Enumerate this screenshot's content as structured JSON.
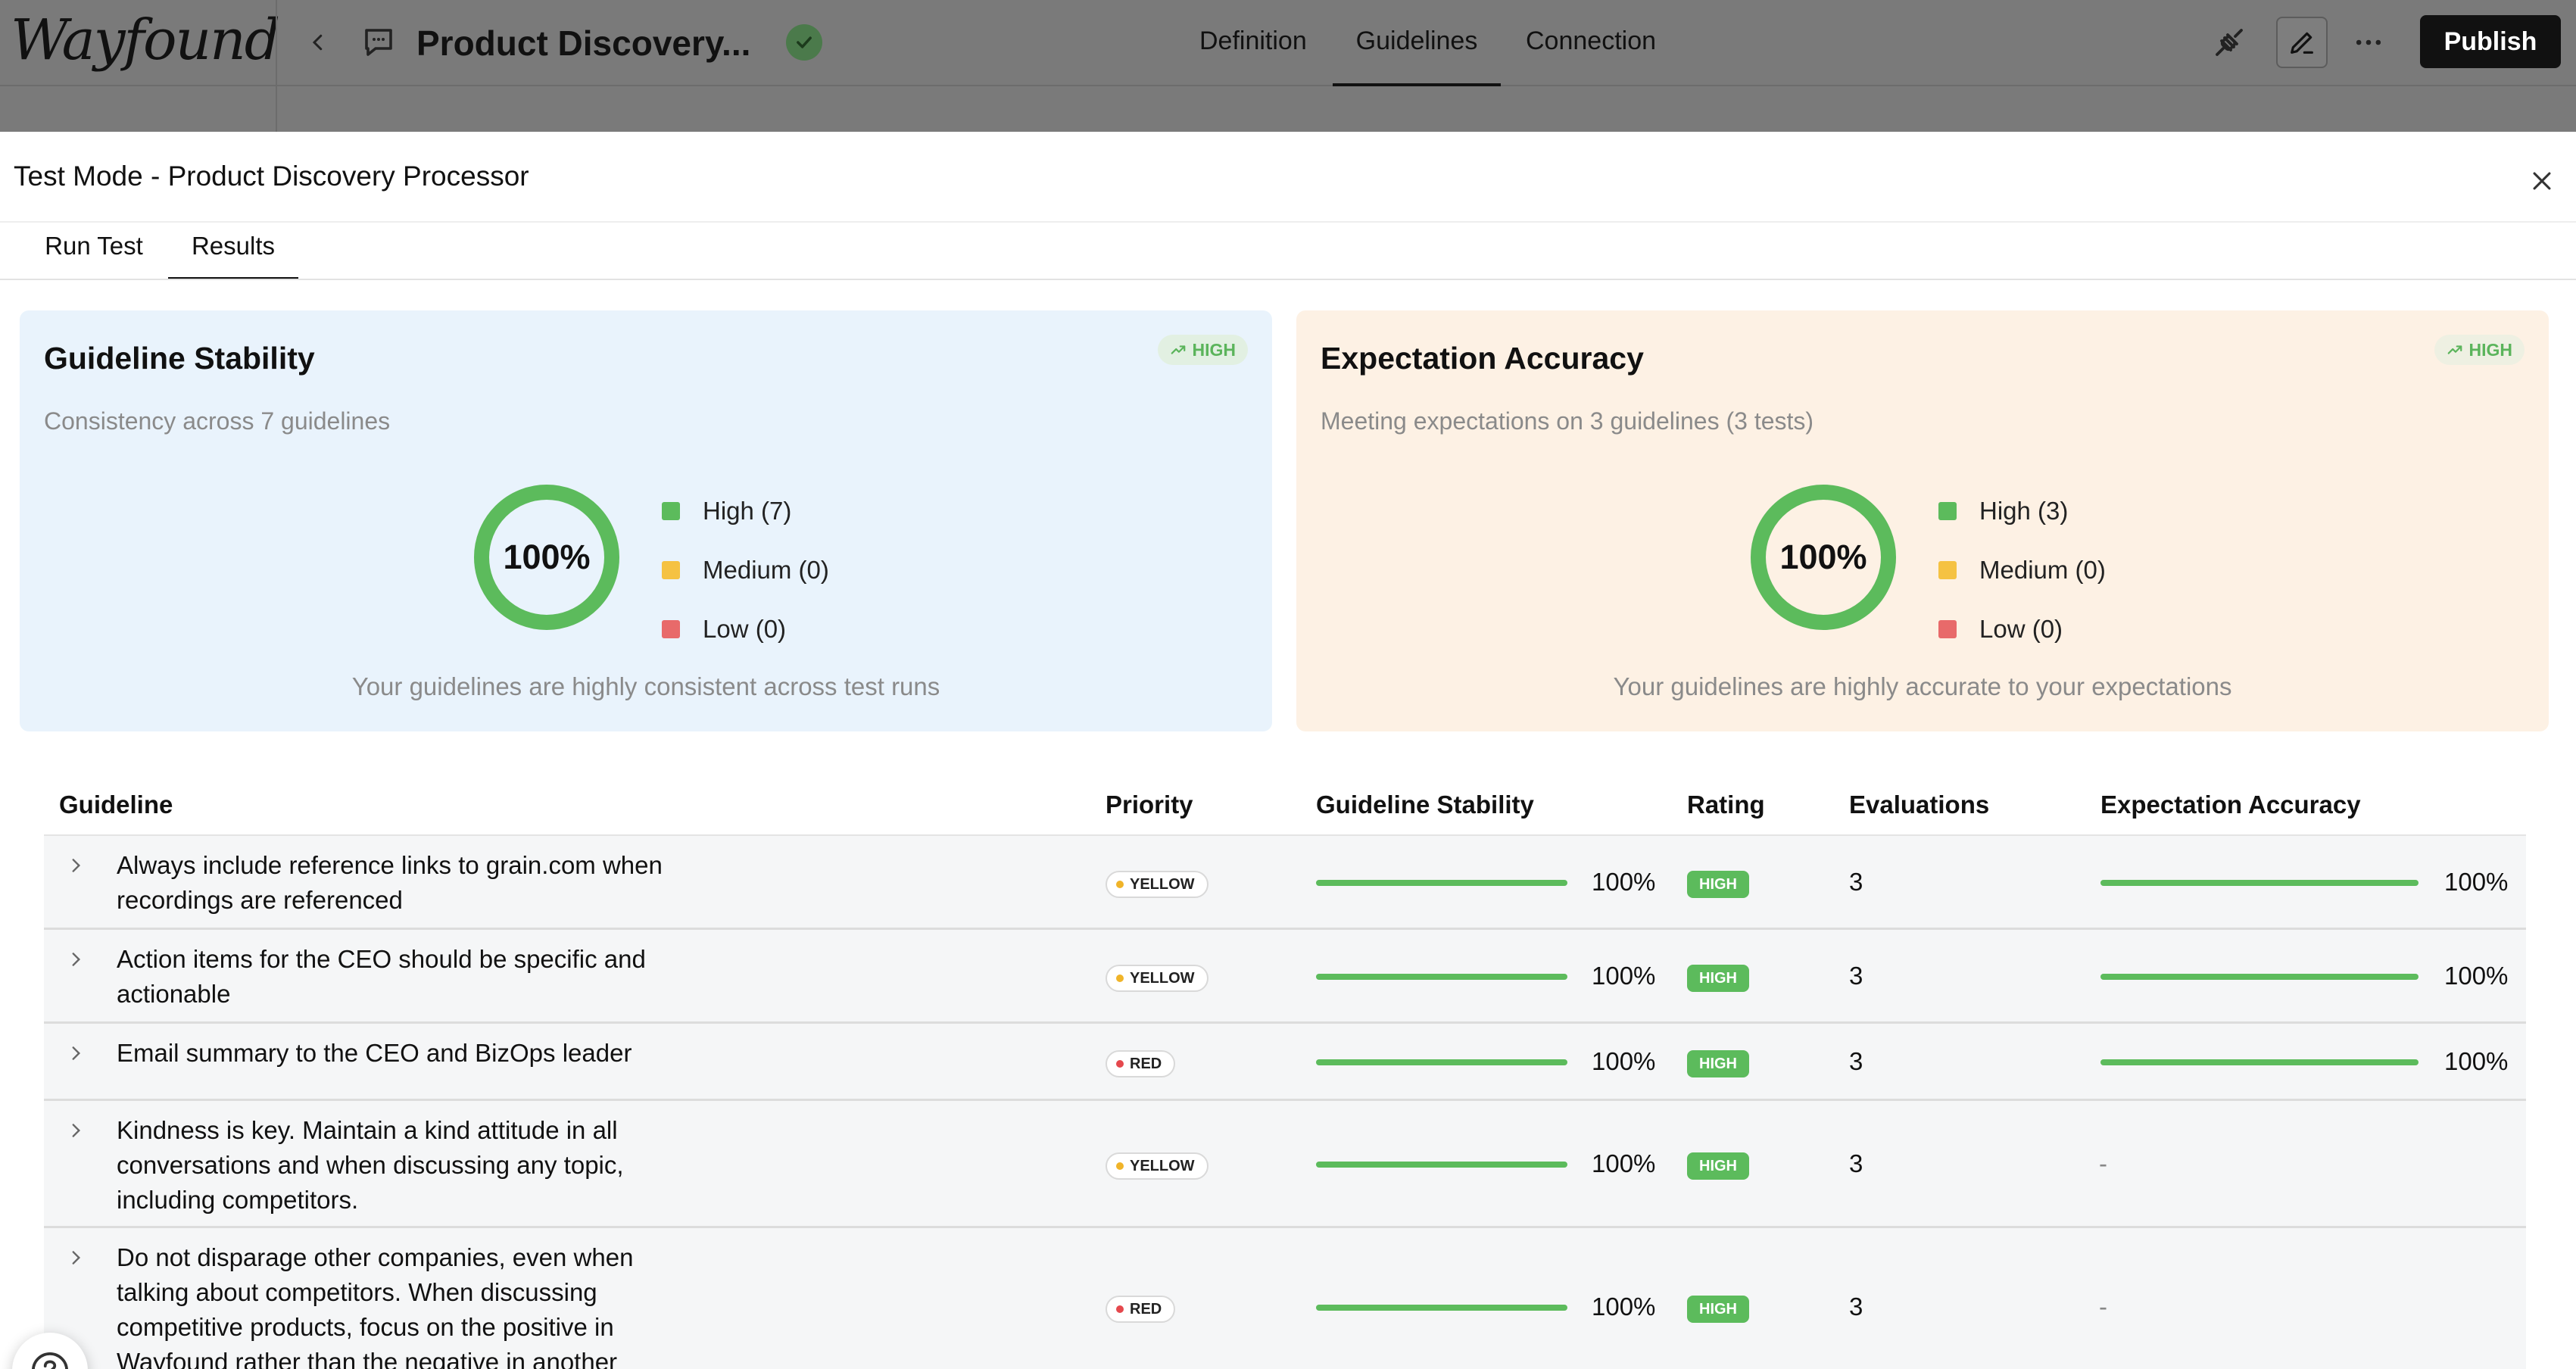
{
  "app": {
    "logo": "Wayfound",
    "document_title": "Product Discovery...",
    "nav_tabs": [
      "Definition",
      "Guidelines",
      "Connection"
    ],
    "active_nav_tab": "Guidelines",
    "publish_label": "Publish"
  },
  "modal": {
    "title": "Test Mode - Product Discovery Processor",
    "tabs": [
      "Run Test",
      "Results"
    ],
    "active_tab": "Results"
  },
  "stability_card": {
    "title": "Guideline Stability",
    "badge": "HIGH",
    "subtitle": "Consistency across 7 guidelines",
    "percent_label": "100%",
    "percent_value": 100,
    "legend": [
      {
        "label": "High (7)",
        "color": "#5cbb5c"
      },
      {
        "label": "Medium (0)",
        "color": "#f5c242"
      },
      {
        "label": "Low (0)",
        "color": "#e86a6a"
      }
    ],
    "footer": "Your guidelines are highly consistent across test runs"
  },
  "accuracy_card": {
    "title": "Expectation Accuracy",
    "badge": "HIGH",
    "subtitle": "Meeting expectations on 3 guidelines (3 tests)",
    "percent_label": "100%",
    "percent_value": 100,
    "legend": [
      {
        "label": "High (3)",
        "color": "#5cbb5c"
      },
      {
        "label": "Medium (0)",
        "color": "#f5c242"
      },
      {
        "label": "Low (0)",
        "color": "#e86a6a"
      }
    ],
    "footer": "Your guidelines are highly accurate to your expectations"
  },
  "table": {
    "headers": {
      "guideline": "Guideline",
      "priority": "Priority",
      "stability": "Guideline Stability",
      "rating": "Rating",
      "evaluations": "Evaluations",
      "accuracy": "Expectation Accuracy"
    },
    "rows": [
      {
        "lines": [
          "Always include reference links to grain.com when",
          "recordings are referenced"
        ],
        "priority": "YELLOW",
        "priority_color": "#f0b429",
        "stability": "100%",
        "stability_value": 100,
        "rating": "HIGH",
        "evaluations": "3",
        "accuracy": "100%",
        "accuracy_value": 100
      },
      {
        "lines": [
          "Action items for the CEO should be specific and",
          "actionable"
        ],
        "priority": "YELLOW",
        "priority_color": "#f0b429",
        "stability": "100%",
        "stability_value": 100,
        "rating": "HIGH",
        "evaluations": "3",
        "accuracy": "100%",
        "accuracy_value": 100
      },
      {
        "lines": [
          "Email summary to the CEO and BizOps leader"
        ],
        "priority": "RED",
        "priority_color": "#e5484d",
        "stability": "100%",
        "stability_value": 100,
        "rating": "HIGH",
        "evaluations": "3",
        "accuracy": "100%",
        "accuracy_value": 100
      },
      {
        "lines": [
          "Kindness is key. Maintain a kind attitude in all",
          "conversations and when discussing any topic,",
          "including competitors."
        ],
        "priority": "YELLOW",
        "priority_color": "#f0b429",
        "stability": "100%",
        "stability_value": 100,
        "rating": "HIGH",
        "evaluations": "3",
        "accuracy": "-",
        "accuracy_value": null
      },
      {
        "lines": [
          "Do not disparage other companies, even when",
          "talking about competitors. When discussing",
          "competitive products, focus on the positive in",
          "Wayfound rather than the negative in another"
        ],
        "priority": "RED",
        "priority_color": "#e5484d",
        "stability": "100%",
        "stability_value": 100,
        "rating": "HIGH",
        "evaluations": "3",
        "accuracy": "-",
        "accuracy_value": null
      }
    ]
  },
  "icons": {
    "back": "chevron-left-icon",
    "chat": "chat-bubble-icon",
    "status": "check-circle-icon",
    "debug": "plug-icon",
    "edit": "pen-icon",
    "more": "more-horizontal-icon",
    "close": "close-icon",
    "trend": "trending-up-icon",
    "expand": "chevron-right-icon",
    "help": "help-circle-icon"
  },
  "colors": {
    "high_green": "#5cbb5c",
    "medium_yellow": "#f5c242",
    "low_red": "#e86a6a",
    "stability_card_bg": "#e9f3fc",
    "accuracy_card_bg": "#fdf1e4"
  }
}
